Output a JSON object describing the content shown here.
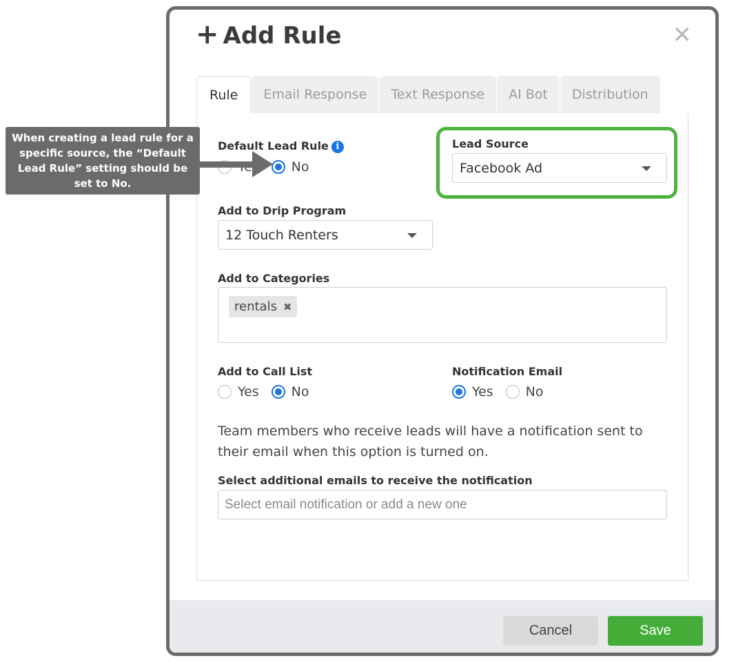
{
  "modal": {
    "title_icon": "plus-icon",
    "title": "Add Rule",
    "close_icon": "close-icon"
  },
  "tabs": [
    {
      "label": "Rule",
      "active": true
    },
    {
      "label": "Email Response",
      "active": false
    },
    {
      "label": "Text Response",
      "active": false
    },
    {
      "label": "AI Bot",
      "active": false
    },
    {
      "label": "Distribution",
      "active": false
    }
  ],
  "default_lead_rule": {
    "label": "Default Lead Rule",
    "info_icon": "info-icon",
    "options": [
      "Yes",
      "No"
    ],
    "selected": "No"
  },
  "lead_source": {
    "label": "Lead Source",
    "value": "Facebook Ad",
    "highlight_color": "#4db33d"
  },
  "drip_program": {
    "label": "Add to Drip Program",
    "value": "12 Touch Renters"
  },
  "categories": {
    "label": "Add to Categories",
    "chips": [
      "rentals"
    ]
  },
  "call_list": {
    "label": "Add to Call List",
    "options": [
      "Yes",
      "No"
    ],
    "selected": "No"
  },
  "notification_email": {
    "label": "Notification Email",
    "options": [
      "Yes",
      "No"
    ],
    "selected": "Yes"
  },
  "description": "Team members who receive leads will have a notification sent to their email when this option is turned on.",
  "additional_emails": {
    "label": "Select additional emails to receive the notification",
    "placeholder": "Select email notification or add a new one"
  },
  "footer": {
    "cancel_label": "Cancel",
    "save_label": "Save"
  },
  "callout": {
    "text": "When creating a lead rule for a specific source, the “Default Lead Rule” setting should be set to No."
  },
  "colors": {
    "accent_blue": "#1a73e8",
    "save_green": "#43ad38",
    "callout_gray": "#6b6b6b"
  }
}
